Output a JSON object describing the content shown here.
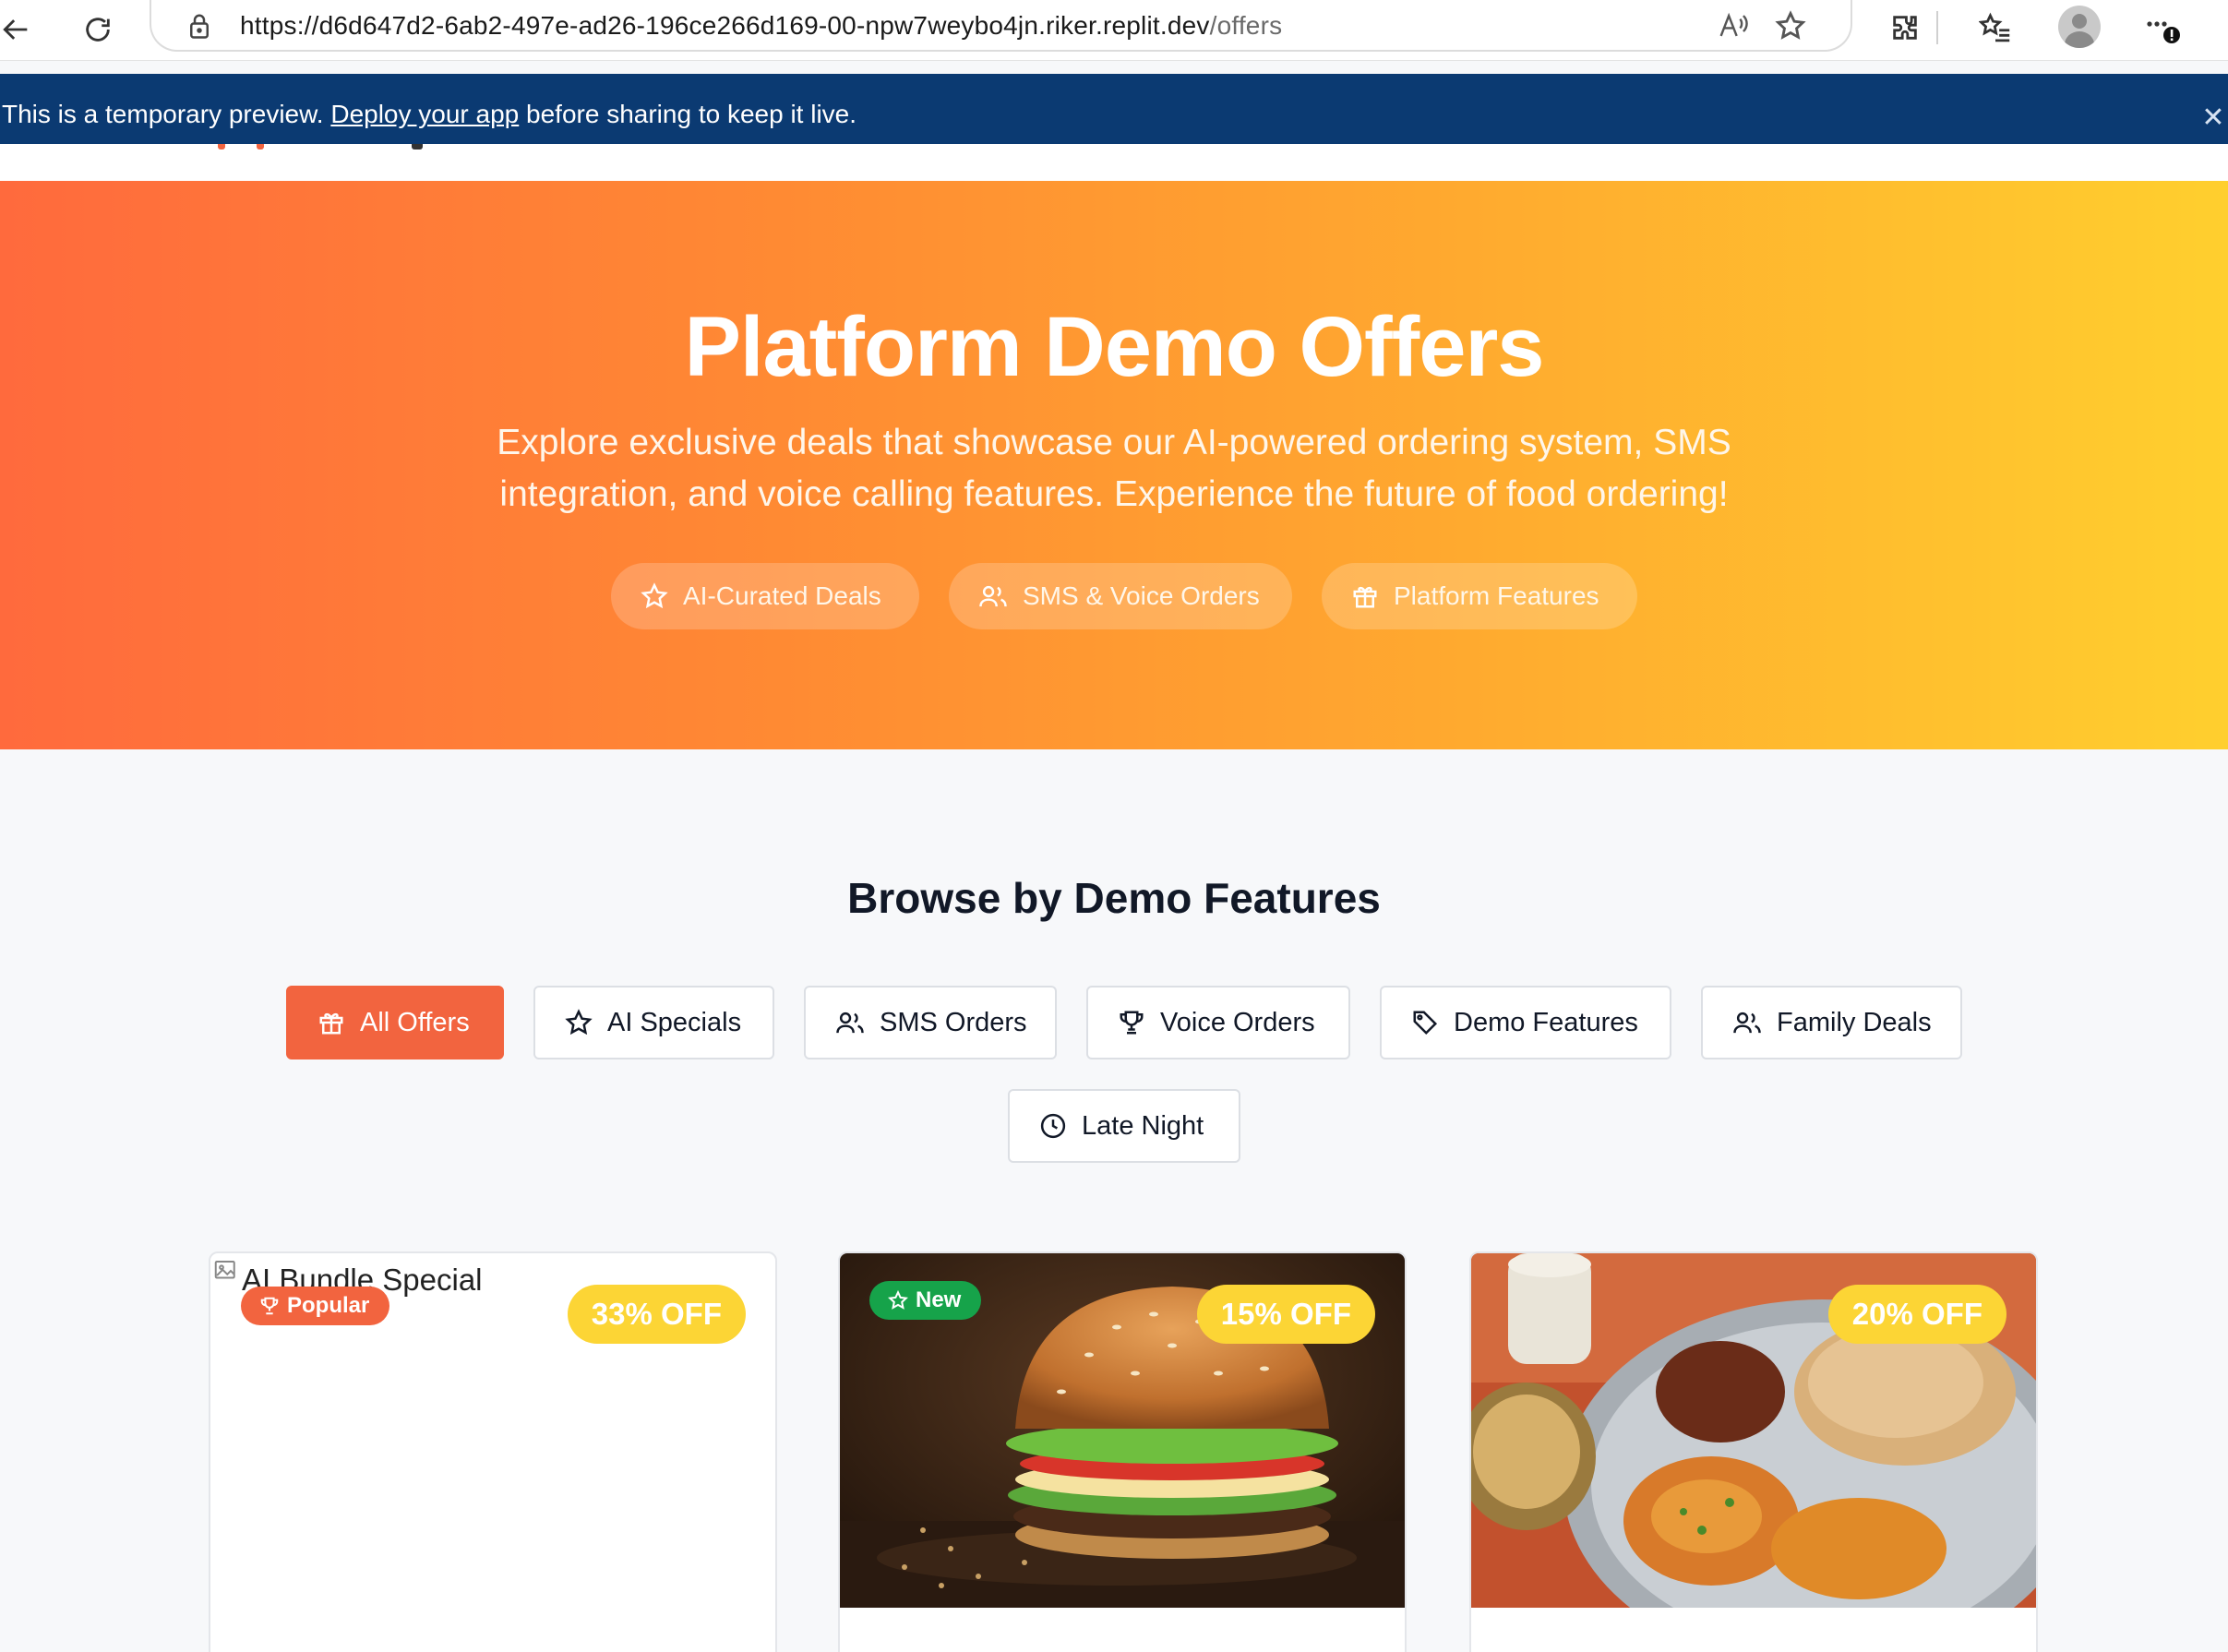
{
  "browser": {
    "url_host": "https://d6d647d2-6ab2-497e-ad26-196ce266d169-00-npw7weybo4jn.riker.replit.dev",
    "url_path": "/offers"
  },
  "banner": {
    "text_before": "This is a temporary preview. ",
    "link_text": "Deploy your app",
    "text_after": " before sharing to keep it live.",
    "close_glyph": "✕"
  },
  "hero": {
    "title": "Platform Demo Offers",
    "subtitle": "Explore exclusive deals that showcase our AI-powered ordering system, SMS integration, and voice calling features. Experience the future of food ordering!",
    "pills": [
      {
        "label": "AI-Curated Deals",
        "icon": "star-icon"
      },
      {
        "label": "SMS & Voice Orders",
        "icon": "users-icon"
      },
      {
        "label": "Platform Features",
        "icon": "gift-icon"
      }
    ]
  },
  "browse": {
    "title": "Browse by Demo Features",
    "filters": [
      {
        "label": "All Offers",
        "icon": "gift-icon",
        "active": true
      },
      {
        "label": "AI Specials",
        "icon": "star-icon",
        "active": false
      },
      {
        "label": "SMS Orders",
        "icon": "users-icon",
        "active": false
      },
      {
        "label": "Voice Orders",
        "icon": "trophy-icon",
        "active": false
      },
      {
        "label": "Demo Features",
        "icon": "tag-icon",
        "active": false
      },
      {
        "label": "Family Deals",
        "icon": "users-icon",
        "active": false
      },
      {
        "label": "Late Night",
        "icon": "clock-icon",
        "active": false
      }
    ]
  },
  "offers": [
    {
      "image_alt": "AI Bundle Special",
      "tag": "Popular",
      "tag_color": "#f2643f",
      "discount": "33% OFF"
    },
    {
      "tag": "New",
      "tag_color": "#16a34a",
      "discount": "15% OFF"
    },
    {
      "tag": "",
      "discount": "20% OFF"
    }
  ],
  "colors": {
    "accent": "#f2643f",
    "banner": "#0b3a72",
    "discount_badge": "#fcd535"
  }
}
